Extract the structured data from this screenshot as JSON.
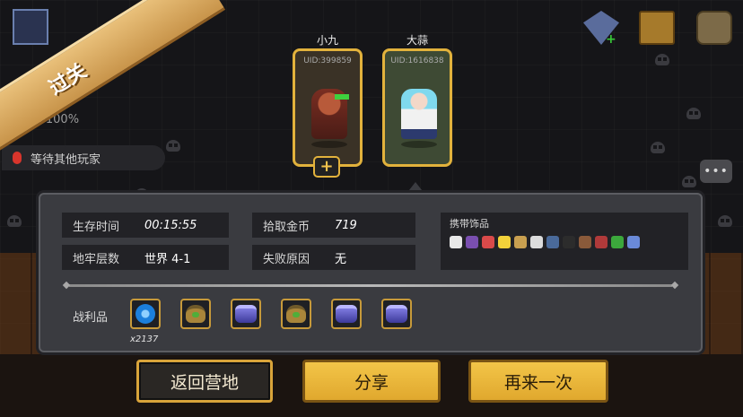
{
  "header": {
    "ribbon_text": "过关"
  },
  "side": {
    "percent_text": "+100%",
    "waiting_text": "等待其他玩家",
    "chat_icon": "chat-bubble-icon"
  },
  "top_icons": [
    "gem-icon",
    "chest-icon",
    "bag-icon"
  ],
  "players": [
    {
      "name": "小九",
      "uid": "UID:399859"
    },
    {
      "name": "大蒜",
      "uid": "UID:1616838"
    }
  ],
  "add_player_label": "+",
  "stats": {
    "survival_time_label": "生存时间",
    "survival_time_value": "00:15:55",
    "coins_label": "拾取金币",
    "coins_value": "719",
    "dungeon_level_label": "地牢层数",
    "dungeon_level_value": "世界 4-1",
    "fail_reason_label": "失败原因",
    "fail_reason_value": "无"
  },
  "accessories": {
    "title": "携带饰品",
    "colors": [
      "#e8e8e8",
      "#7a4fb0",
      "#d94a4a",
      "#f2d23a",
      "#c9a050",
      "#dcdcdc",
      "#4a6a9a",
      "#2c2c2c",
      "#8a5a3a",
      "#b03a3a",
      "#3ca83c",
      "#6a8ad8"
    ]
  },
  "loot": {
    "label": "战利品",
    "first_qty": "x2137",
    "items": [
      "blue-gem-icon",
      "seed-bag-icon",
      "purple-pot-icon",
      "seed-bag-icon",
      "purple-pot-icon",
      "purple-pot-icon"
    ]
  },
  "buttons": {
    "return_camp": "返回营地",
    "share": "分享",
    "again": "再来一次"
  },
  "colors": {
    "accent_gold": "#e2b23c",
    "panel": "#3a3b40",
    "ribbon": "#e9c07a"
  }
}
